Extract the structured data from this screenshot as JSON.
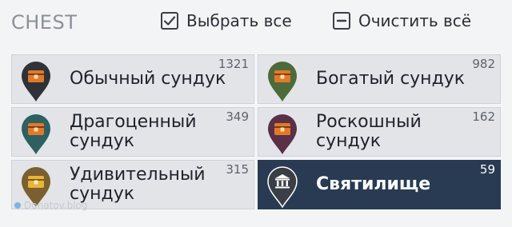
{
  "header": {
    "title": "CHEST",
    "select_all": "Выбрать все",
    "clear_all": "Очистить всё"
  },
  "items": [
    {
      "label": "Обычный сундук",
      "count": "1321",
      "pin_color": "#2f3237",
      "icon": "chest-icon"
    },
    {
      "label": "Богатый сундук",
      "count": "982",
      "pin_color": "#4f6a3a",
      "icon": "chest-icon"
    },
    {
      "label": "Драгоценный сундук",
      "count": "349",
      "pin_color": "#2e6062",
      "icon": "chest-icon"
    },
    {
      "label": "Роскошный сундук",
      "count": "162",
      "pin_color": "#5a2f48",
      "icon": "chest-icon"
    },
    {
      "label": "Удивительный сундук",
      "count": "315",
      "pin_color": "#7a6030",
      "icon": "chest-icon"
    },
    {
      "label": "Святилище",
      "count": "59",
      "pin_color": "#3a3f46",
      "icon": "shrine-icon",
      "selected": true
    }
  ],
  "watermark": "Donatov.blog",
  "colors": {
    "selected_bg": "#283b52",
    "card_bg": "#e2e4e7",
    "chest_orange": "#e07a2a"
  }
}
